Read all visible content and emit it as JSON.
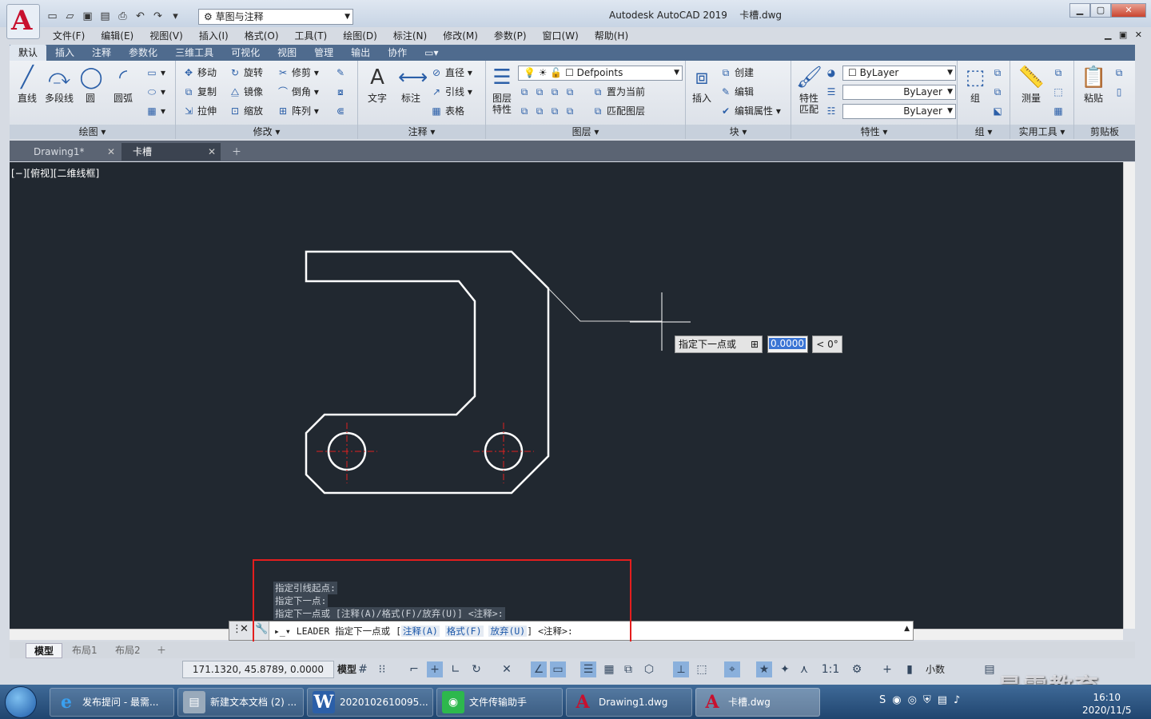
{
  "app": {
    "title": "Autodesk AutoCAD 2019",
    "file": "卡槽.dwg",
    "workspace": "草图与注释"
  },
  "menu": [
    "文件(F)",
    "编辑(E)",
    "视图(V)",
    "插入(I)",
    "格式(O)",
    "工具(T)",
    "绘图(D)",
    "标注(N)",
    "修改(M)",
    "参数(P)",
    "窗口(W)",
    "帮助(H)"
  ],
  "ribbon_tabs": [
    "默认",
    "插入",
    "注释",
    "参数化",
    "三维工具",
    "可视化",
    "视图",
    "管理",
    "输出",
    "协作"
  ],
  "draw": {
    "title": "绘图",
    "line": "直线",
    "pline": "多段线",
    "circle": "圆",
    "arc": "圆弧"
  },
  "modify": {
    "title": "修改",
    "move": "移动",
    "rotate": "旋转",
    "trim": "修剪",
    "copy": "复制",
    "mirror": "镜像",
    "fillet": "倒角",
    "stretch": "拉伸",
    "scale": "缩放",
    "array": "阵列"
  },
  "annot": {
    "title": "注释",
    "text": "文字",
    "dim": "标注",
    "diameter": "直径",
    "leader": "引线",
    "table": "表格"
  },
  "layers": {
    "title": "图层",
    "layer_props": "图层\n特性",
    "current_layer": "Defpoints",
    "set_current": "置为当前",
    "match_layer": "匹配图层"
  },
  "block": {
    "title": "块",
    "insert": "插入",
    "create": "创建",
    "edit": "编辑",
    "edit_attr": "编辑属性"
  },
  "props": {
    "title": "特性",
    "match": "特性\n匹配",
    "color": "ByLayer",
    "linetype": "ByLayer",
    "lineweight": "ByLayer"
  },
  "groups": {
    "title": "组",
    "group": "组"
  },
  "utilities": {
    "title": "实用工具",
    "measure": "测量"
  },
  "clipboard": {
    "title": "剪贴板",
    "paste": "粘贴"
  },
  "doc_tabs": [
    {
      "label": "Drawing1*"
    },
    {
      "label": "卡槽"
    }
  ],
  "viewport_label": "[−][俯视][二维线框]",
  "dyn_input": {
    "prompt": "指定下一点或",
    "value": "0.0000",
    "angle": "< 0°"
  },
  "history": [
    "指定引线起点:",
    "指定下一点:",
    "指定下一点或 [注释(A)/格式(F)/放弃(U)] <注释>:"
  ],
  "cmd": {
    "prefix": "LEADER 指定下一点或 [",
    "opt1": "注释(A)",
    "opt2": "格式(F)",
    "opt3": "放弃(U)",
    "suffix": "] <注释>:"
  },
  "layout_tabs": [
    "模型",
    "布局1",
    "布局2"
  ],
  "status": {
    "coords": "171.1320, 45.8789, 0.0000",
    "model": "模型",
    "scale": "1:1",
    "units": "小数"
  },
  "taskbar": [
    {
      "label": "发布提问 - 最需..."
    },
    {
      "label": "新建文本文档 (2) ..."
    },
    {
      "label": "2020102610095..."
    },
    {
      "label": "文件传输助手"
    },
    {
      "label": "Drawing1.dwg"
    },
    {
      "label": "卡槽.dwg"
    }
  ],
  "clock": {
    "time": "16:10",
    "date": "2020/11/5"
  },
  "watermark": "最需教育",
  "colors": {
    "canvas": "#212830",
    "accent": "#e41e1e",
    "crosshair": "#ffffff"
  }
}
